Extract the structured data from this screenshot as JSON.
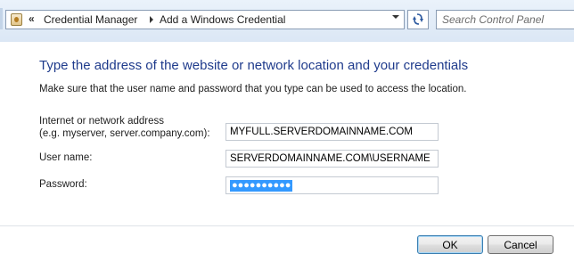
{
  "address_bar": {
    "overflow_chevron": "«",
    "breadcrumbs": [
      {
        "label": "Credential Manager"
      },
      {
        "label": "Add a Windows Credential"
      }
    ],
    "search_placeholder": "Search Control Panel"
  },
  "content": {
    "title": "Type the address of the website or network location and your credentials",
    "subtitle": "Make sure that the user name and password that you type can be used to access the location.",
    "fields": {
      "address": {
        "label_line1": "Internet or network address",
        "label_line2": "(e.g. myserver, server.company.com):",
        "value": "MYFULL.SERVERDOMAINNAME.COM"
      },
      "username": {
        "label": "User name:",
        "value": "SERVERDOMAINNAME.COM\\USERNAME"
      },
      "password": {
        "label": "Password:",
        "masked_value": "●●●●●●●●●●",
        "selected": true
      }
    }
  },
  "buttons": {
    "ok": "OK",
    "cancel": "Cancel"
  },
  "colors": {
    "title": "#1f3b8c",
    "selection": "#3399ff",
    "address_strip": "#dbe7f5"
  },
  "icons": [
    "control-panel-icon",
    "refresh-icon",
    "dropdown-arrow-icon",
    "breadcrumb-arrow-icon"
  ]
}
